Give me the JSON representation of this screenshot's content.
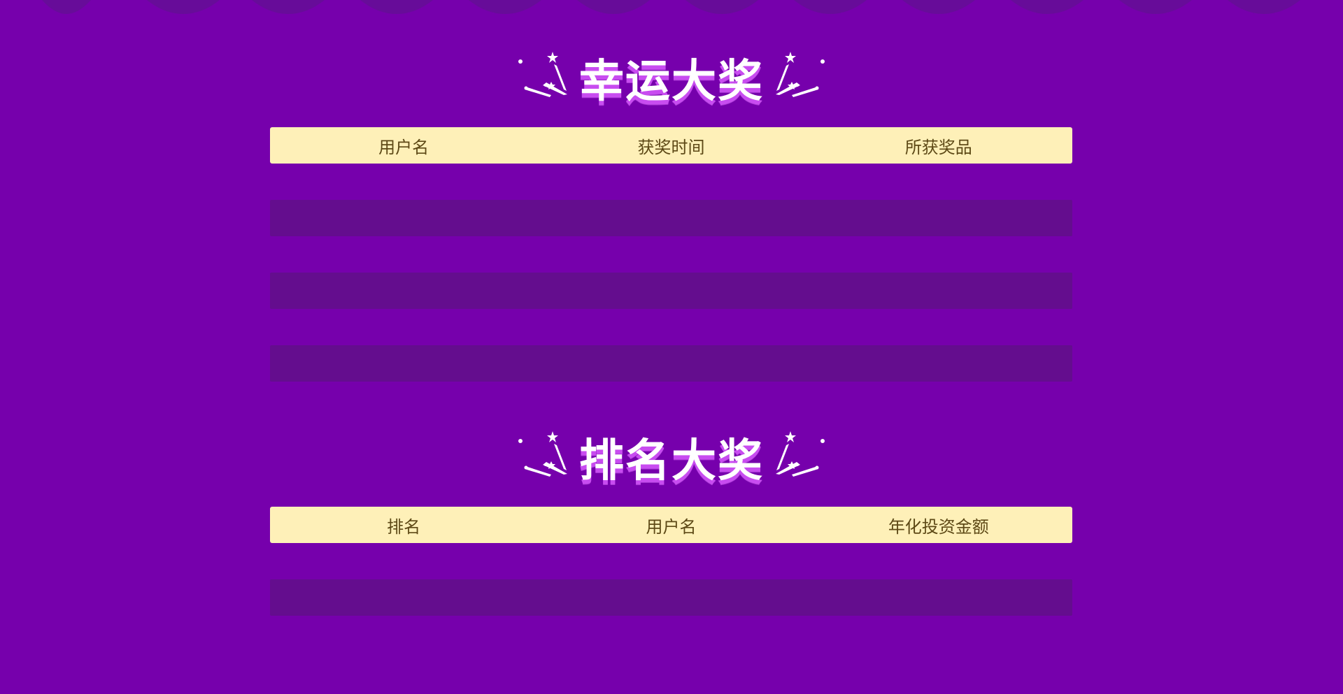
{
  "lucky_prizes": {
    "title": "幸运大奖",
    "columns": [
      "用户名",
      "获奖时间",
      "所获奖品"
    ],
    "rows": []
  },
  "ranking_prizes": {
    "title": "排名大奖",
    "columns": [
      "排名",
      "用户名",
      "年化投资金额"
    ],
    "rows": []
  },
  "colors": {
    "background": "#7600ac",
    "header_bg": "#fef0b8",
    "header_text": "#5d4916",
    "alt_row": "#640d8e",
    "title_shadow": "#c84cf0"
  },
  "icons": {
    "title_decoration": "firework-icon",
    "top_border": "scallop-border"
  }
}
